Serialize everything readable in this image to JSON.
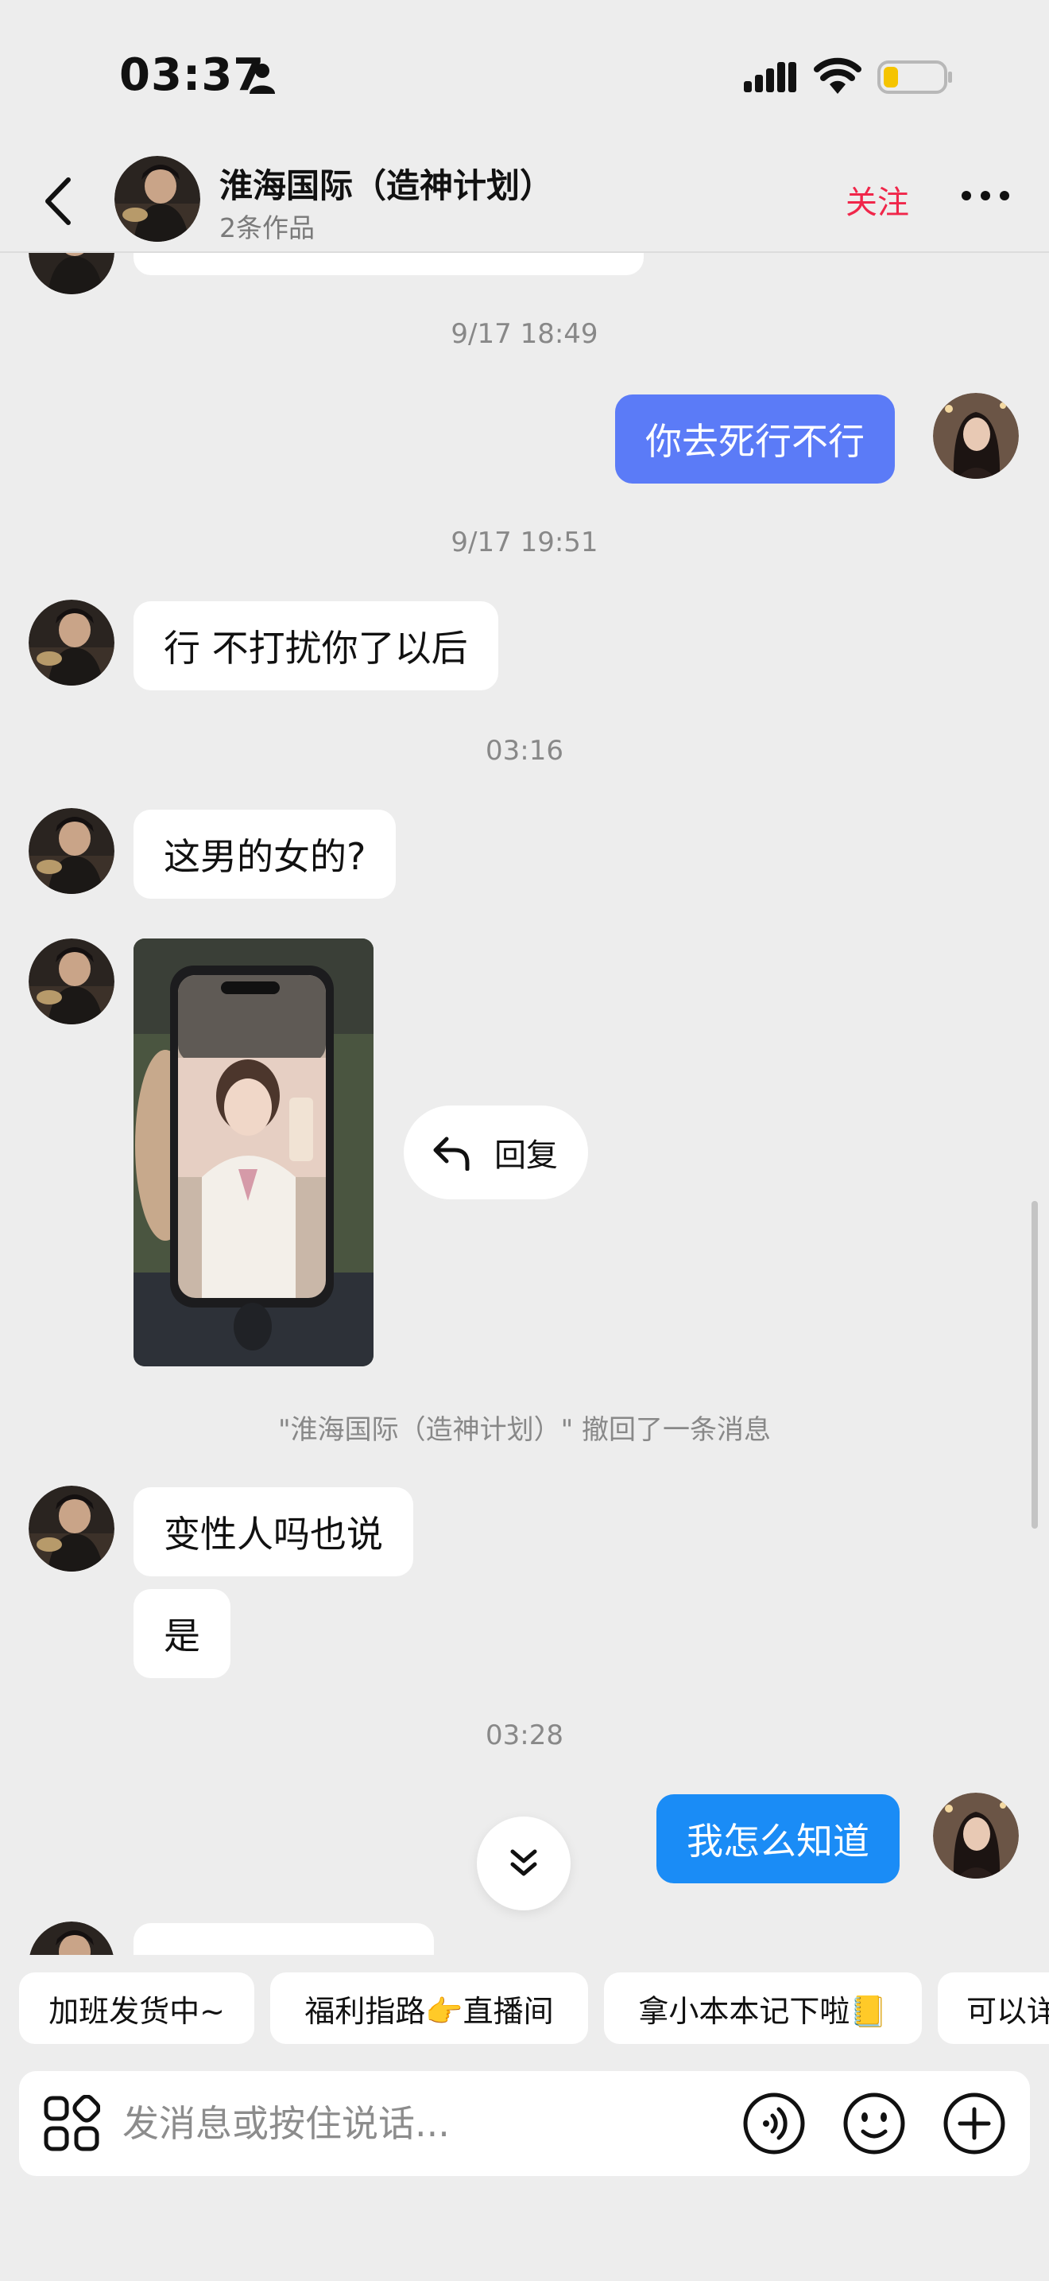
{
  "status_bar": {
    "time": "03:37"
  },
  "header": {
    "title": "淮海国际（造神计划）",
    "subtitle": "2条作品",
    "follow_label": "关注",
    "accent_color": "#f0264a"
  },
  "messages": {
    "ts1": "9/17 18:49",
    "out1": "你去死行不行",
    "ts2": "9/17 19:51",
    "in1": "行 不打扰你了以后",
    "ts3": "03:16",
    "in2": "这男的女的?",
    "reply_label": "回复",
    "recall_notice": "\"淮海国际（造神计划）\" 撤回了一条消息",
    "in3": "变性人吗也说",
    "in4": "是",
    "ts4": "03:28",
    "out2": "我怎么知道"
  },
  "quick_replies": [
    "加班发货中~",
    "福利指路👉直播间",
    "拿小本本记下啦📒",
    "可以详"
  ],
  "input": {
    "placeholder": "发消息或按住说话..."
  },
  "colors": {
    "bubble_purple": "#5b7bf7",
    "bubble_blue": "#1a8cf6",
    "background": "#ededed"
  }
}
